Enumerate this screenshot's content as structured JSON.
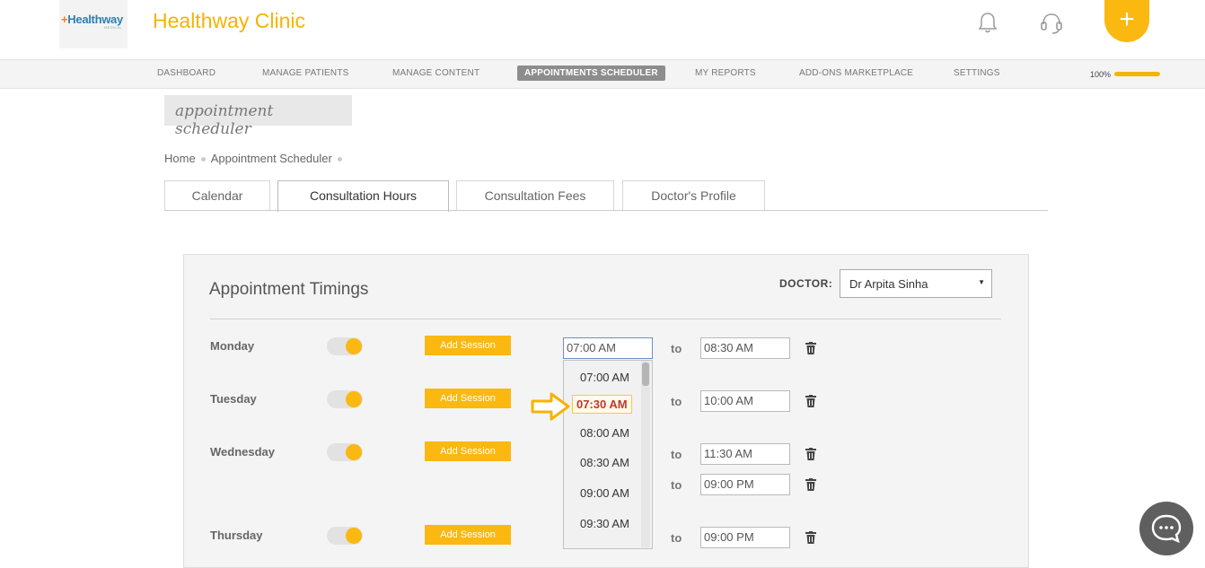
{
  "header": {
    "logo_text_plus": "+",
    "logo_text": "Healthway",
    "logo_sub": "MEDICAL",
    "clinic_name": "Healthway Clinic",
    "add_label": "+"
  },
  "nav": {
    "items": [
      "DASHBOARD",
      "MANAGE PATIENTS",
      "MANAGE CONTENT",
      "APPOINTMENTS SCHEDULER",
      "MY REPORTS",
      "ADD-ONS MARKETPLACE",
      "SETTINGS"
    ],
    "active": "APPOINTMENTS SCHEDULER",
    "progress_label": "100%",
    "progress_value": 1.0
  },
  "page": {
    "section_tag": "appointment scheduler",
    "breadcrumb": [
      "Home",
      "Appointment Scheduler"
    ],
    "tabs": [
      "Calendar",
      "Consultation Hours",
      "Consultation Fees",
      "Doctor's Profile"
    ],
    "active_tab": "Consultation Hours"
  },
  "panel": {
    "title": "Appointment Timings",
    "doctor_label": "DOCTOR:",
    "doctor_value": "Dr Arpita Sinha",
    "add_session_label": "Add Session",
    "to_label": "to",
    "days": [
      {
        "name": "Monday",
        "enabled": true,
        "sessions": [
          {
            "from": "07:00 AM",
            "to": "08:30 AM"
          }
        ]
      },
      {
        "name": "Tuesday",
        "enabled": true,
        "sessions": [
          {
            "to": "10:00 AM"
          }
        ]
      },
      {
        "name": "Wednesday",
        "enabled": true,
        "sessions": [
          {
            "to": "11:30 AM"
          },
          {
            "to": "09:00 PM"
          }
        ]
      },
      {
        "name": "Thursday",
        "enabled": true,
        "sessions": [
          {
            "to": "09:00 PM"
          }
        ]
      }
    ]
  },
  "dropdown": {
    "options": [
      "07:00 AM",
      "07:30 AM",
      "08:00 AM",
      "08:30 AM",
      "09:00 AM",
      "09:30 AM"
    ],
    "highlighted": "07:30 AM"
  },
  "colors": {
    "accent": "#fbb811",
    "brand_text": "#f4b400",
    "nav_active": "#8d8d8d",
    "chat": "#5f5f5f"
  },
  "icons": {
    "bell": "bell-icon",
    "headset": "headset-icon",
    "trash": "trash-icon",
    "chat": "chat-icon",
    "arrow": "arrow-right-icon"
  }
}
